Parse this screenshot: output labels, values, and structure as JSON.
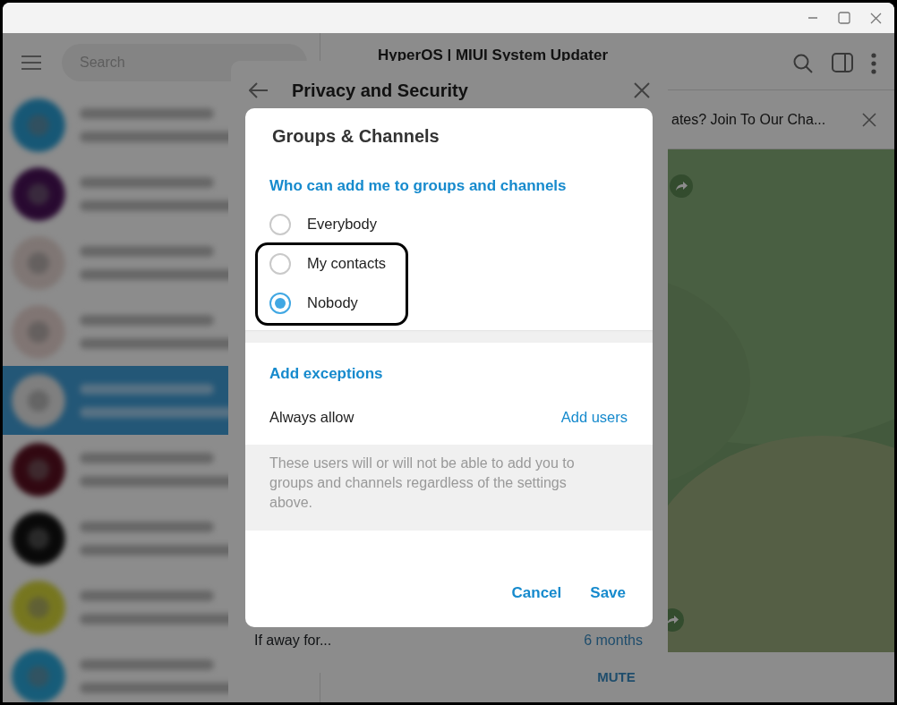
{
  "sidebar": {
    "search": {
      "placeholder": "Search"
    },
    "chats": [
      {
        "selected": false
      },
      {
        "selected": false
      },
      {
        "selected": false
      },
      {
        "selected": false
      },
      {
        "selected": true
      },
      {
        "selected": false
      },
      {
        "selected": false
      },
      {
        "selected": false
      },
      {
        "selected": false
      }
    ]
  },
  "chat": {
    "title": "HyperOS | MIUI System Updater",
    "pinned": "ates? Join To Our Cha...",
    "action": "MUTE"
  },
  "panel": {
    "title": "Privacy and Security",
    "rows": [
      {
        "label": "If away for...",
        "value": "6 months"
      }
    ]
  },
  "dialog": {
    "title": "Groups & Channels",
    "heading": "Who can add me to groups and channels",
    "options": [
      {
        "label": "Everybody",
        "selected": false,
        "highlighted": false
      },
      {
        "label": "My contacts",
        "selected": false,
        "highlighted": true
      },
      {
        "label": "Nobody",
        "selected": true,
        "highlighted": true
      }
    ],
    "exceptions_heading": "Add exceptions",
    "exception": {
      "label": "Always allow",
      "link": "Add users"
    },
    "note": "These users will or will not be able to add you to groups and channels regardless of the settings above.",
    "buttons": [
      "Cancel",
      "Save"
    ]
  }
}
